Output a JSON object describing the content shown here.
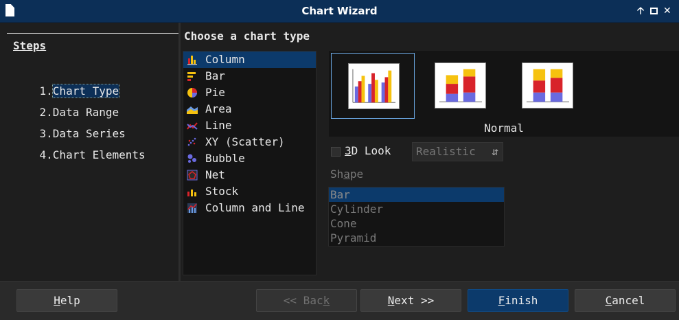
{
  "window": {
    "title": "Chart Wizard",
    "controls": {
      "up": "🡡",
      "close": "✕"
    }
  },
  "steps": {
    "title": "Steps",
    "items": [
      {
        "num": "1.",
        "label": "Chart Type",
        "active": true
      },
      {
        "num": "2.",
        "label": "Data Range",
        "active": false
      },
      {
        "num": "3.",
        "label": "Data Series",
        "active": false
      },
      {
        "num": "4.",
        "label": "Chart Elements",
        "active": false
      }
    ]
  },
  "main": {
    "heading": "Choose a chart type",
    "chart_types": [
      {
        "label": "Column",
        "icon": "column-chart-icon",
        "selected": true
      },
      {
        "label": "Bar",
        "icon": "bar-chart-icon",
        "selected": false
      },
      {
        "label": "Pie",
        "icon": "pie-chart-icon",
        "selected": false
      },
      {
        "label": "Area",
        "icon": "area-chart-icon",
        "selected": false
      },
      {
        "label": "Line",
        "icon": "line-chart-icon",
        "selected": false
      },
      {
        "label": "XY (Scatter)",
        "icon": "scatter-chart-icon",
        "selected": false
      },
      {
        "label": "Bubble",
        "icon": "bubble-chart-icon",
        "selected": false
      },
      {
        "label": "Net",
        "icon": "net-chart-icon",
        "selected": false
      },
      {
        "label": "Stock",
        "icon": "stock-chart-icon",
        "selected": false
      },
      {
        "label": "Column and Line",
        "icon": "column-line-chart-icon",
        "selected": false
      }
    ],
    "variants": [
      {
        "name": "normal-column-variant",
        "selected": true
      },
      {
        "name": "stacked-column-variant",
        "selected": false
      },
      {
        "name": "percent-stacked-column-variant",
        "selected": false
      }
    ],
    "variant_caption": "Normal",
    "look": {
      "checkbox_prefix": "",
      "checkbox_mnemonic": "3",
      "checkbox_rest": "D Look",
      "checked": false,
      "select_value": "Realistic",
      "spin_glyph": "⇵"
    },
    "shape": {
      "label_pre": "Sh",
      "label_mnemonic": "a",
      "label_post": "pe",
      "options": [
        {
          "label": "Bar",
          "selected": true
        },
        {
          "label": "Cylinder",
          "selected": false
        },
        {
          "label": "Cone",
          "selected": false
        },
        {
          "label": "Pyramid",
          "selected": false
        }
      ]
    }
  },
  "footer": {
    "help": {
      "pre": "",
      "mn": "H",
      "post": "elp"
    },
    "back": {
      "pre": "<< Bac",
      "mn": "k",
      "post": ""
    },
    "next": {
      "pre": "",
      "mn": "N",
      "post": "ext >>"
    },
    "finish": {
      "pre": "",
      "mn": "F",
      "post": "inish"
    },
    "cancel": {
      "pre": "",
      "mn": "C",
      "post": "ancel"
    }
  },
  "colors": {
    "accent": "#0c3a6b",
    "titlebar": "#0c2f57",
    "bar_yellow": "#f6c20f",
    "bar_red": "#d8232a",
    "bar_blue": "#6a6ae0"
  }
}
